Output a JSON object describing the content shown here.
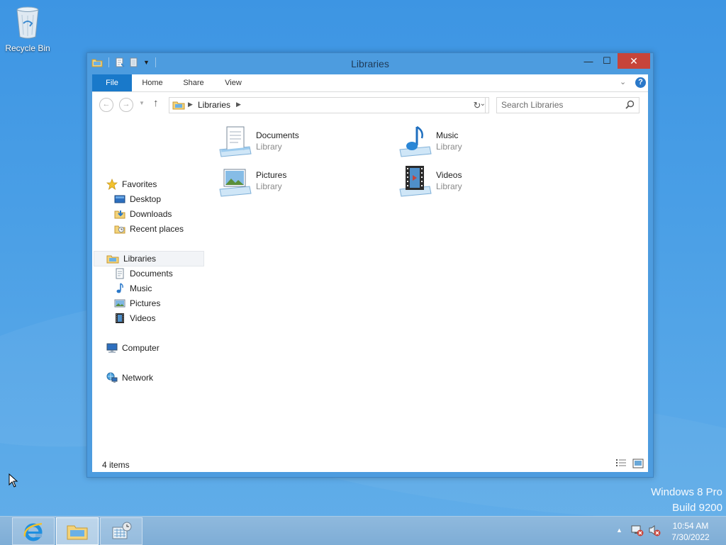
{
  "desktop": {
    "recycle_bin_label": "Recycle Bin",
    "watermark": {
      "line1": "Windows 8 Pro",
      "line2": "Build 9200"
    }
  },
  "window": {
    "title": "Libraries",
    "minimize_glyph": "—",
    "maximize_glyph": "☐",
    "close_glyph": "✕",
    "ribbon": {
      "tabs": [
        {
          "label": "File"
        },
        {
          "label": "Home"
        },
        {
          "label": "Share"
        },
        {
          "label": "View"
        }
      ],
      "help_glyph": "?"
    },
    "address": {
      "breadcrumb": "Libraries",
      "search_placeholder": "Search Libraries"
    },
    "nav_pane": {
      "favorites": {
        "label": "Favorites",
        "items": [
          {
            "label": "Desktop"
          },
          {
            "label": "Downloads"
          },
          {
            "label": "Recent places"
          }
        ]
      },
      "libraries": {
        "label": "Libraries",
        "items": [
          {
            "label": "Documents"
          },
          {
            "label": "Music"
          },
          {
            "label": "Pictures"
          },
          {
            "label": "Videos"
          }
        ]
      },
      "computer": {
        "label": "Computer"
      },
      "network": {
        "label": "Network"
      }
    },
    "files": [
      {
        "name": "Documents",
        "type": "Library",
        "icon": "documents-library-icon"
      },
      {
        "name": "Music",
        "type": "Library",
        "icon": "music-library-icon"
      },
      {
        "name": "Pictures",
        "type": "Library",
        "icon": "pictures-library-icon"
      },
      {
        "name": "Videos",
        "type": "Library",
        "icon": "videos-library-icon"
      }
    ],
    "status": {
      "item_count": "4 items"
    }
  },
  "taskbar": {
    "pinned": [
      {
        "name": "Internet Explorer",
        "icon": "ie-icon"
      },
      {
        "name": "File Explorer",
        "icon": "folder-icon"
      },
      {
        "name": "Control Panel",
        "icon": "monitor-icon"
      }
    ],
    "clock": {
      "time": "10:54 AM",
      "date": "7/30/2022"
    }
  },
  "colors": {
    "accent": "#1979ca",
    "window_frame": "#4d9cdf",
    "close_button": "#c7443a",
    "desktop": "#4a9fe6"
  }
}
